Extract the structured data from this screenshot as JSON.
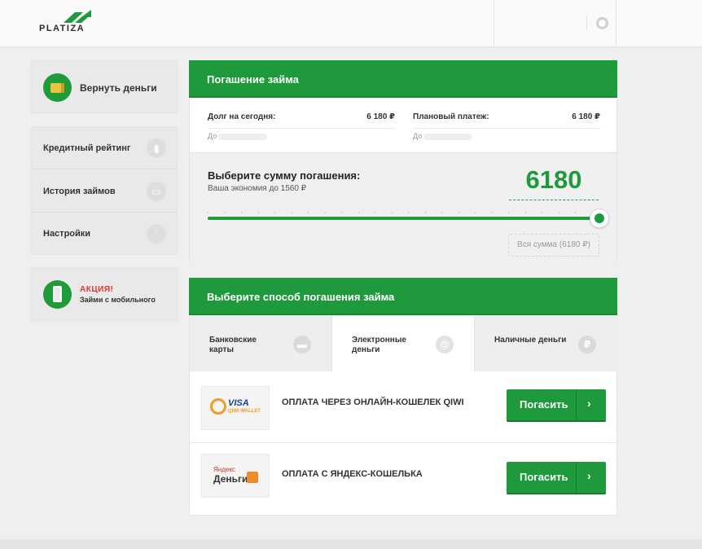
{
  "header": {
    "logo_text": "PLATIZA",
    "brand_color": "#1e9a3c"
  },
  "sidebar": {
    "refund_label": "Вернуть деньги",
    "menu": [
      {
        "label": "Кредитный рейтинг",
        "icon": "bar-chart-icon"
      },
      {
        "label": "История займов",
        "icon": "document-icon"
      },
      {
        "label": "Настройки",
        "icon": "sliders-icon"
      }
    ],
    "promo": {
      "title": "АКЦИЯ!",
      "subtitle": "Займи с мобильного"
    }
  },
  "repay": {
    "title": "Погашение займа",
    "debt_label": "Долг на сегодня:",
    "debt_value": "6 180 ₽",
    "debt_sub": "До",
    "plan_label": "Плановый платеж:",
    "plan_value": "6 180 ₽",
    "plan_sub": "До",
    "choose_label": "Выберите сумму погашения:",
    "savings": "Ваша экономия до 1560 ₽",
    "amount": "6180",
    "slider_fraction": 1.0,
    "all_sum": "Вся сумма (6180 ₽)"
  },
  "method": {
    "title": "Выберите способ погашения займа",
    "tabs": [
      {
        "label": "Банковские карты",
        "icon": "card-icon"
      },
      {
        "label": "Электронные деньги",
        "icon": "at-icon",
        "active": true
      },
      {
        "label": "Наличные деньги",
        "icon": "ruble-icon"
      }
    ],
    "rows": [
      {
        "logo_top": "VISA",
        "logo_bottom": "QIWI WALLET",
        "text": "ОПЛАТА ЧЕРЕЗ ОНЛАЙН-КОШЕЛЕК QIWI",
        "button": "Погасить"
      },
      {
        "logo_top": "Яндекс",
        "logo_bottom": "Деньги",
        "text": "ОПЛАТА С ЯНДЕКС-КОШЕЛЬКА",
        "button": "Погасить"
      }
    ]
  }
}
